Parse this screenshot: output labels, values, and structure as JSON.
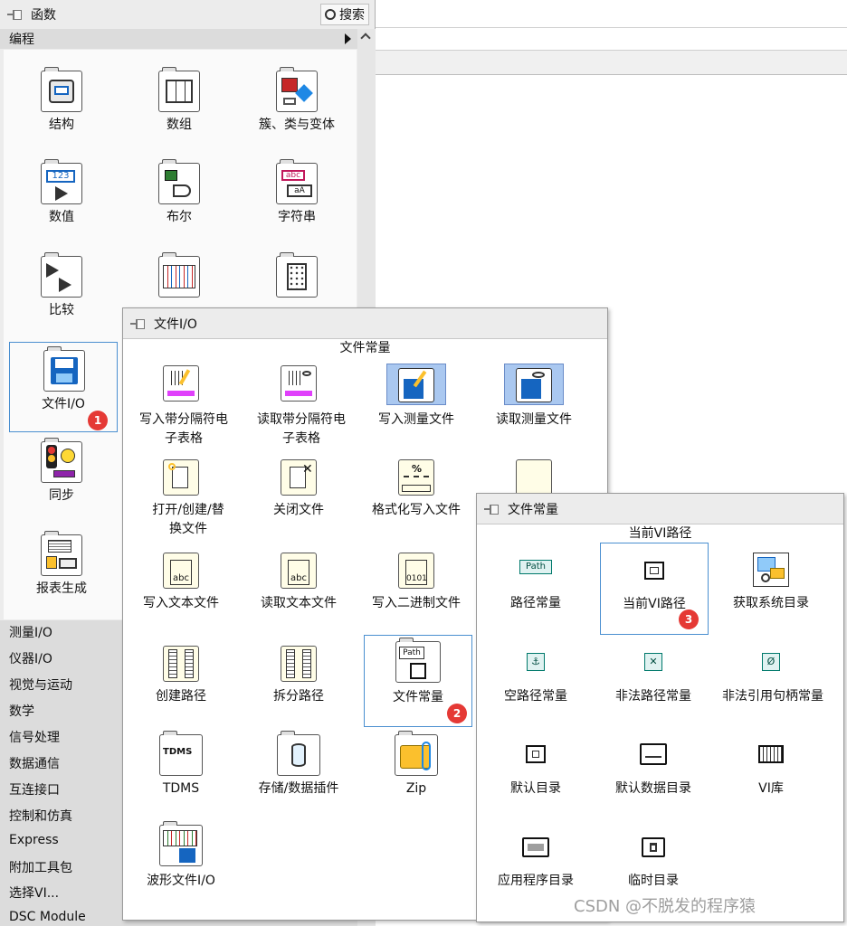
{
  "functions_palette": {
    "title": "函数",
    "search_label": "搜索",
    "section": "编程",
    "items": [
      {
        "label": "结构"
      },
      {
        "label": "数组"
      },
      {
        "label": "簇、类与变体"
      },
      {
        "label": "数值"
      },
      {
        "label": "布尔"
      },
      {
        "label": "字符串"
      },
      {
        "label": "比较"
      },
      {
        "label": "文件I/O"
      },
      {
        "label": "同步"
      },
      {
        "label": "报表生成"
      }
    ],
    "badge": "1",
    "categories": [
      "测量I/O",
      "仪器I/O",
      "视觉与运动",
      "数学",
      "信号处理",
      "数据通信",
      "互连接口",
      "控制和仿真",
      "Express",
      "附加工具包",
      "选择VI...",
      "DSC Module"
    ]
  },
  "file_io_palette": {
    "title": "文件I/O",
    "header": "文件常量",
    "items": [
      {
        "label": "写入带分隔符电子表格"
      },
      {
        "label": "读取带分隔符电子表格"
      },
      {
        "label": "写入测量文件"
      },
      {
        "label": "读取测量文件"
      },
      {
        "label": "打开/创建/替换文件"
      },
      {
        "label": "关闭文件"
      },
      {
        "label": "格式化写入文件"
      },
      {
        "label": "写入文本文件"
      },
      {
        "label": "读取文本文件"
      },
      {
        "label": "写入二进制文件"
      },
      {
        "label": "创建路径"
      },
      {
        "label": "拆分路径"
      },
      {
        "label": "文件常量"
      },
      {
        "label": "TDMS"
      },
      {
        "label": "存储/数据插件"
      },
      {
        "label": "Zip"
      },
      {
        "label": "波形文件I/O"
      }
    ],
    "badge": "2",
    "icon_texts": {
      "path": "Path",
      "tdms": "TDMS",
      "abc": "abc",
      "bin": "0101",
      "fmt": "%"
    }
  },
  "file_constants_palette": {
    "title": "文件常量",
    "header": "当前VI路径",
    "items": [
      {
        "label": "路径常量"
      },
      {
        "label": "当前VI路径"
      },
      {
        "label": "获取系统目录"
      },
      {
        "label": "空路径常量"
      },
      {
        "label": "非法路径常量"
      },
      {
        "label": "非法引用句柄常量"
      },
      {
        "label": "默认目录"
      },
      {
        "label": "默认数据目录"
      },
      {
        "label": "VI库"
      },
      {
        "label": "应用程序目录"
      },
      {
        "label": "临时目录"
      }
    ],
    "badge": "3",
    "icon_texts": {
      "path": "Path"
    }
  },
  "watermark": "CSDN @不脱发的程序猿"
}
